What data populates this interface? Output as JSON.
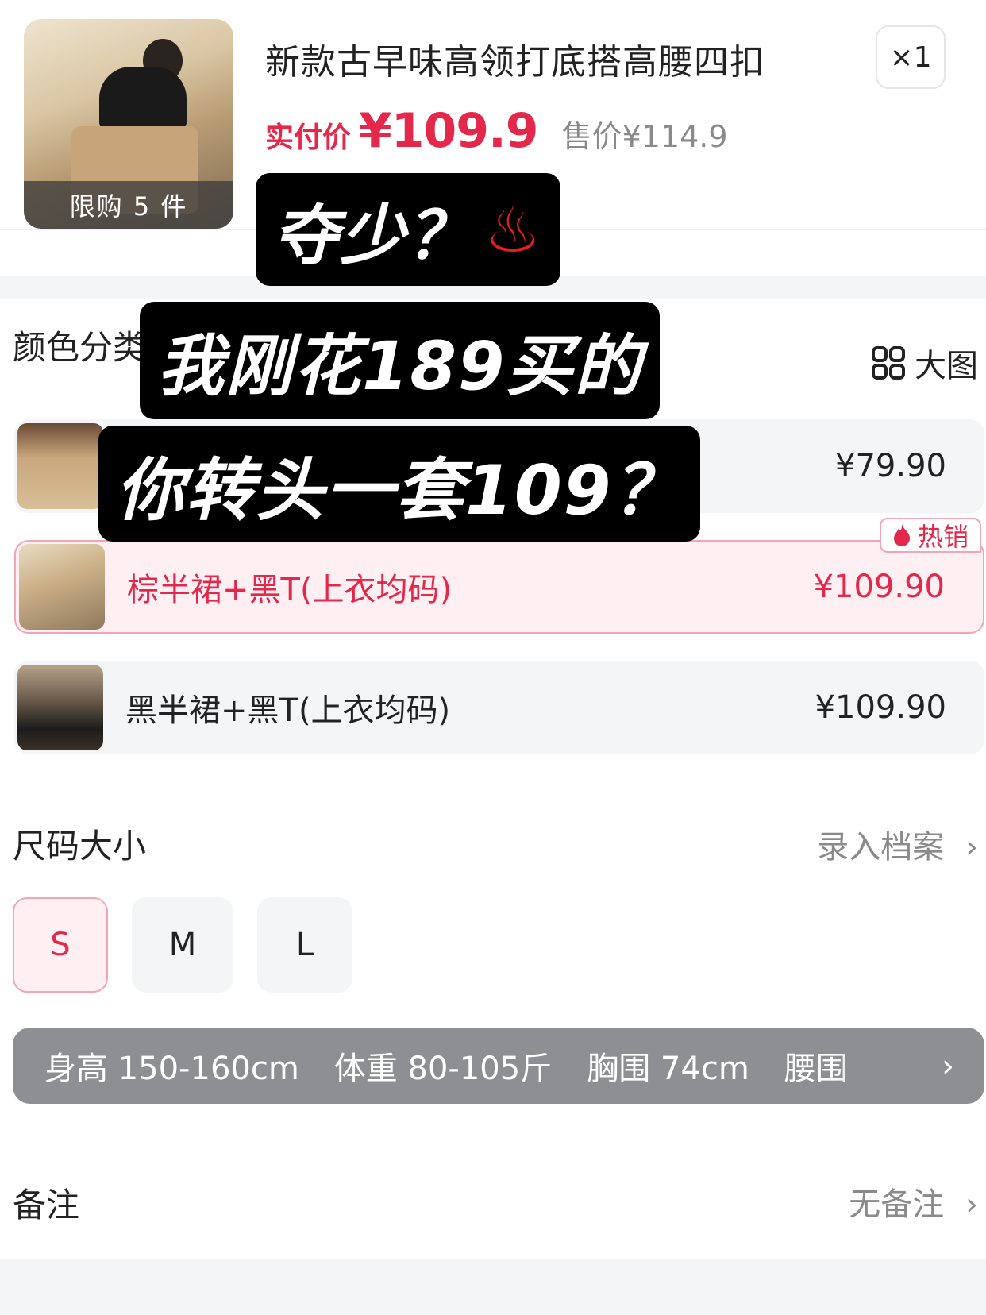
{
  "product": {
    "title": "新款古早味高领打底搭高腰四扣",
    "limit": "限购 5 件",
    "qty": "×1",
    "paid_label": "实付价",
    "paid_price": "¥109.9",
    "orig_price": "售价¥114.9"
  },
  "color_section": {
    "label": "颜色分类",
    "big_view": "大图",
    "variants": [
      {
        "name": "",
        "price": "¥79.90"
      },
      {
        "name": "棕半裙+黑T(上衣均码)",
        "price": "¥109.90",
        "badge": "热销"
      },
      {
        "name": "黑半裙+黑T(上衣均码)",
        "price": "¥109.90"
      }
    ]
  },
  "size_section": {
    "label": "尺码大小",
    "link": "录入档案",
    "sizes": [
      "S",
      "M",
      "L"
    ],
    "selected": "S",
    "tip": [
      "身高 150-160cm",
      "体重 80-105斤",
      "胸围 74cm",
      "腰围"
    ]
  },
  "remark": {
    "label": "备注",
    "value": "无备注"
  },
  "overlay": {
    "line1": "夺少？",
    "line2": "我刚花189买的",
    "line3": "你转头一套109？"
  }
}
